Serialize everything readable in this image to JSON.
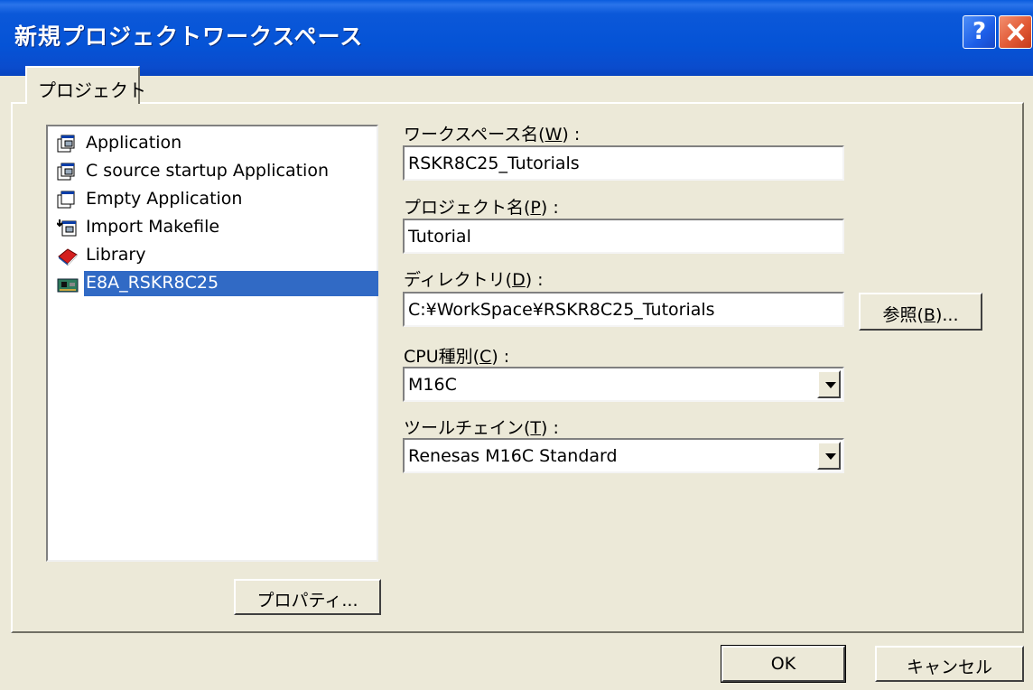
{
  "window": {
    "title": "新規プロジェクトワークスペース"
  },
  "titlebar": {
    "help_label": "?"
  },
  "tabs": [
    {
      "label": "プロジェクト"
    }
  ],
  "project_types": [
    {
      "label": "Application",
      "icon": "application-icon"
    },
    {
      "label": "C source startup Application",
      "icon": "application-icon"
    },
    {
      "label": "Empty Application",
      "icon": "empty-application-icon"
    },
    {
      "label": "Import Makefile",
      "icon": "import-makefile-icon"
    },
    {
      "label": "Library",
      "icon": "library-icon"
    },
    {
      "label": "E8A_RSKR8C25",
      "icon": "board-icon",
      "selected": true
    }
  ],
  "fields": {
    "workspace": {
      "label_pre": "ワークスペース名(",
      "label_key": "W",
      "label_post": ") :",
      "value": "RSKR8C25_Tutorials"
    },
    "project": {
      "label_pre": "プロジェクト名(",
      "label_key": "P",
      "label_post": ") :",
      "value": "Tutorial"
    },
    "directory": {
      "label_pre": "ディレクトリ(",
      "label_key": "D",
      "label_post": ") :",
      "value": "C:¥WorkSpace¥RSKR8C25_Tutorials"
    },
    "cpu": {
      "label_pre": "CPU種別(",
      "label_key": "C",
      "label_post": ") :",
      "value": "M16C"
    },
    "toolchain": {
      "label_pre": "ツールチェイン(",
      "label_key": "T",
      "label_post": ") :",
      "value": "Renesas M16C Standard"
    }
  },
  "buttons": {
    "browse_pre": "参照(",
    "browse_key": "B",
    "browse_post": ")...",
    "properties": "プロパティ...",
    "ok": "OK",
    "cancel": "キャンセル"
  },
  "colors": {
    "titlebar": "#0553d6",
    "selection": "#316ac5",
    "dialog_bg": "#ece9d8"
  }
}
